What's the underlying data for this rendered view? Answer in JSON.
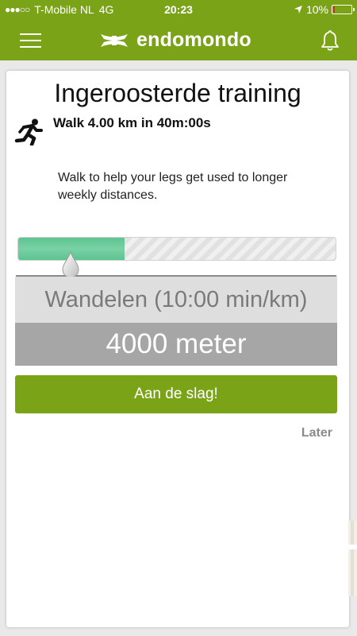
{
  "status_bar": {
    "carrier": "T-Mobile NL",
    "network": "4G",
    "time": "20:23",
    "battery": "10%",
    "battery_level": 0.1
  },
  "nav": {
    "brand": "endomondo",
    "menu_icon": "hamburger-menu-icon",
    "bell_icon": "bell-icon",
    "logo_icon": "under-armour-logo-icon"
  },
  "card": {
    "title": "Ingeroosterde training",
    "summary": "Walk 4.00 km in 40m:00s",
    "runner_icon": "running-person-icon",
    "description": "Walk to help your legs get used to longer weekly distances.",
    "progress": 0.335,
    "activity": "Wandelen (10:00 min/km)",
    "distance": "4000 meter",
    "start_button": "Aan de slag!",
    "later_link": "Later"
  },
  "colors": {
    "brand_green": "#7ba318",
    "progress_fill": "#5dc48f",
    "battery_low": "#d4301f"
  }
}
